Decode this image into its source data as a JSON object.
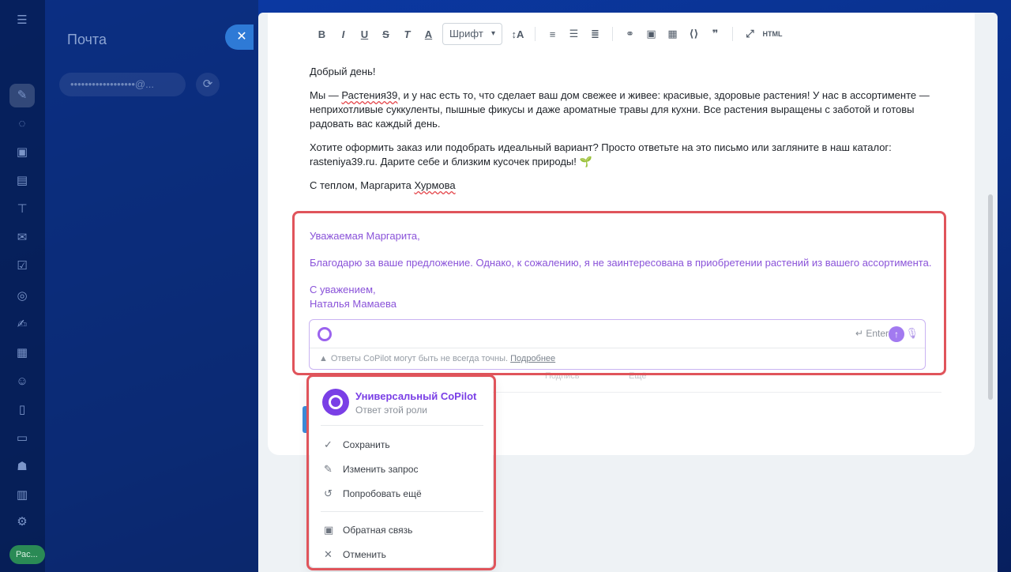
{
  "app": {
    "title": "Почта",
    "account_masked": "••••••••••••••••••@...",
    "rail_bottom_label": "Рас..."
  },
  "toolbar": {
    "font_label": "Шрифт",
    "html_label": "HTML"
  },
  "email": {
    "greeting": "Добрый день!",
    "para1_prefix": "Мы — ",
    "para1_brand": "Растения39",
    "para1_rest": ", и у нас есть то, что сделает ваш дом свежее и живее: красивые, здоровые растения! У нас в ассортименте — неприхотливые суккуленты, пышные фикусы и даже ароматные травы для кухни. Все растения выращены с заботой и готовы радовать вас каждый день.",
    "para2": "Хотите оформить заказ или подобрать идеальный вариант? Просто ответьте на это письмо или загляните в наш каталог: rasteniya39.ru. Дарите себе и близким кусочек природы! 🌱",
    "signoff_prefix": "С теплом, Маргарита ",
    "signoff_name": "Хурмова"
  },
  "ai_reply": {
    "salutation": "Уважаемая Маргарита,",
    "body": "Благодарю за ваше предложение. Однако, к сожалению, я не заинтересована в приобретении растений из вашего ассортимента.",
    "closing": "С уважением,",
    "name": "Наталья Мамаева"
  },
  "prompt": {
    "placeholder": "",
    "enter_hint": "Enter",
    "disclaimer": "Ответы CoPilot могут быть не всегда точны.",
    "more_link": "Подробнее"
  },
  "faint_row": {
    "signature": "Подпись",
    "more": "Ещё"
  },
  "menu": {
    "title": "Универсальный CoPilot",
    "subtitle": "Ответ этой роли",
    "items": [
      {
        "label": "Сохранить"
      },
      {
        "label": "Изменить запрос"
      },
      {
        "label": "Попробовать ещё"
      },
      {
        "label": "Обратная связь"
      },
      {
        "label": "Отменить"
      }
    ]
  },
  "colors": {
    "accent": "#7a3fe6",
    "highlight": "#e0545b",
    "ai_text": "#8a53d9"
  }
}
